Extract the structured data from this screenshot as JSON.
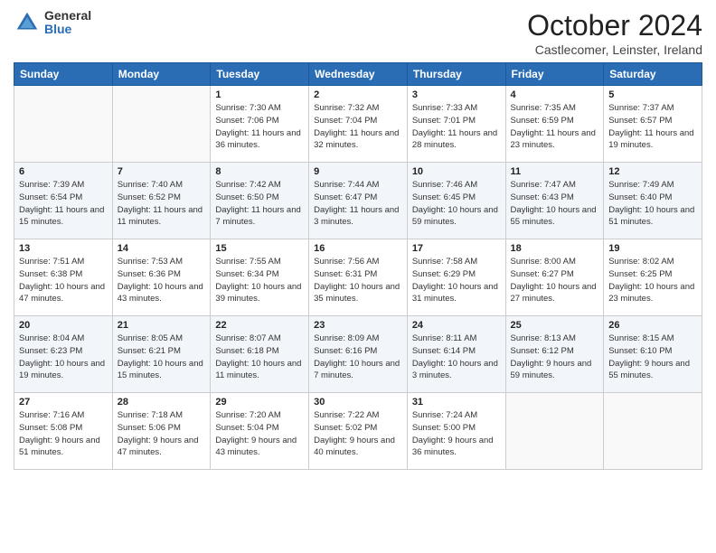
{
  "header": {
    "logo_general": "General",
    "logo_blue": "Blue",
    "title": "October 2024",
    "location": "Castlecomer, Leinster, Ireland"
  },
  "days_of_week": [
    "Sunday",
    "Monday",
    "Tuesday",
    "Wednesday",
    "Thursday",
    "Friday",
    "Saturday"
  ],
  "weeks": [
    [
      {
        "day": "",
        "info": ""
      },
      {
        "day": "",
        "info": ""
      },
      {
        "day": "1",
        "info": "Sunrise: 7:30 AM\nSunset: 7:06 PM\nDaylight: 11 hours and 36 minutes."
      },
      {
        "day": "2",
        "info": "Sunrise: 7:32 AM\nSunset: 7:04 PM\nDaylight: 11 hours and 32 minutes."
      },
      {
        "day": "3",
        "info": "Sunrise: 7:33 AM\nSunset: 7:01 PM\nDaylight: 11 hours and 28 minutes."
      },
      {
        "day": "4",
        "info": "Sunrise: 7:35 AM\nSunset: 6:59 PM\nDaylight: 11 hours and 23 minutes."
      },
      {
        "day": "5",
        "info": "Sunrise: 7:37 AM\nSunset: 6:57 PM\nDaylight: 11 hours and 19 minutes."
      }
    ],
    [
      {
        "day": "6",
        "info": "Sunrise: 7:39 AM\nSunset: 6:54 PM\nDaylight: 11 hours and 15 minutes."
      },
      {
        "day": "7",
        "info": "Sunrise: 7:40 AM\nSunset: 6:52 PM\nDaylight: 11 hours and 11 minutes."
      },
      {
        "day": "8",
        "info": "Sunrise: 7:42 AM\nSunset: 6:50 PM\nDaylight: 11 hours and 7 minutes."
      },
      {
        "day": "9",
        "info": "Sunrise: 7:44 AM\nSunset: 6:47 PM\nDaylight: 11 hours and 3 minutes."
      },
      {
        "day": "10",
        "info": "Sunrise: 7:46 AM\nSunset: 6:45 PM\nDaylight: 10 hours and 59 minutes."
      },
      {
        "day": "11",
        "info": "Sunrise: 7:47 AM\nSunset: 6:43 PM\nDaylight: 10 hours and 55 minutes."
      },
      {
        "day": "12",
        "info": "Sunrise: 7:49 AM\nSunset: 6:40 PM\nDaylight: 10 hours and 51 minutes."
      }
    ],
    [
      {
        "day": "13",
        "info": "Sunrise: 7:51 AM\nSunset: 6:38 PM\nDaylight: 10 hours and 47 minutes."
      },
      {
        "day": "14",
        "info": "Sunrise: 7:53 AM\nSunset: 6:36 PM\nDaylight: 10 hours and 43 minutes."
      },
      {
        "day": "15",
        "info": "Sunrise: 7:55 AM\nSunset: 6:34 PM\nDaylight: 10 hours and 39 minutes."
      },
      {
        "day": "16",
        "info": "Sunrise: 7:56 AM\nSunset: 6:31 PM\nDaylight: 10 hours and 35 minutes."
      },
      {
        "day": "17",
        "info": "Sunrise: 7:58 AM\nSunset: 6:29 PM\nDaylight: 10 hours and 31 minutes."
      },
      {
        "day": "18",
        "info": "Sunrise: 8:00 AM\nSunset: 6:27 PM\nDaylight: 10 hours and 27 minutes."
      },
      {
        "day": "19",
        "info": "Sunrise: 8:02 AM\nSunset: 6:25 PM\nDaylight: 10 hours and 23 minutes."
      }
    ],
    [
      {
        "day": "20",
        "info": "Sunrise: 8:04 AM\nSunset: 6:23 PM\nDaylight: 10 hours and 19 minutes."
      },
      {
        "day": "21",
        "info": "Sunrise: 8:05 AM\nSunset: 6:21 PM\nDaylight: 10 hours and 15 minutes."
      },
      {
        "day": "22",
        "info": "Sunrise: 8:07 AM\nSunset: 6:18 PM\nDaylight: 10 hours and 11 minutes."
      },
      {
        "day": "23",
        "info": "Sunrise: 8:09 AM\nSunset: 6:16 PM\nDaylight: 10 hours and 7 minutes."
      },
      {
        "day": "24",
        "info": "Sunrise: 8:11 AM\nSunset: 6:14 PM\nDaylight: 10 hours and 3 minutes."
      },
      {
        "day": "25",
        "info": "Sunrise: 8:13 AM\nSunset: 6:12 PM\nDaylight: 9 hours and 59 minutes."
      },
      {
        "day": "26",
        "info": "Sunrise: 8:15 AM\nSunset: 6:10 PM\nDaylight: 9 hours and 55 minutes."
      }
    ],
    [
      {
        "day": "27",
        "info": "Sunrise: 7:16 AM\nSunset: 5:08 PM\nDaylight: 9 hours and 51 minutes."
      },
      {
        "day": "28",
        "info": "Sunrise: 7:18 AM\nSunset: 5:06 PM\nDaylight: 9 hours and 47 minutes."
      },
      {
        "day": "29",
        "info": "Sunrise: 7:20 AM\nSunset: 5:04 PM\nDaylight: 9 hours and 43 minutes."
      },
      {
        "day": "30",
        "info": "Sunrise: 7:22 AM\nSunset: 5:02 PM\nDaylight: 9 hours and 40 minutes."
      },
      {
        "day": "31",
        "info": "Sunrise: 7:24 AM\nSunset: 5:00 PM\nDaylight: 9 hours and 36 minutes."
      },
      {
        "day": "",
        "info": ""
      },
      {
        "day": "",
        "info": ""
      }
    ]
  ]
}
